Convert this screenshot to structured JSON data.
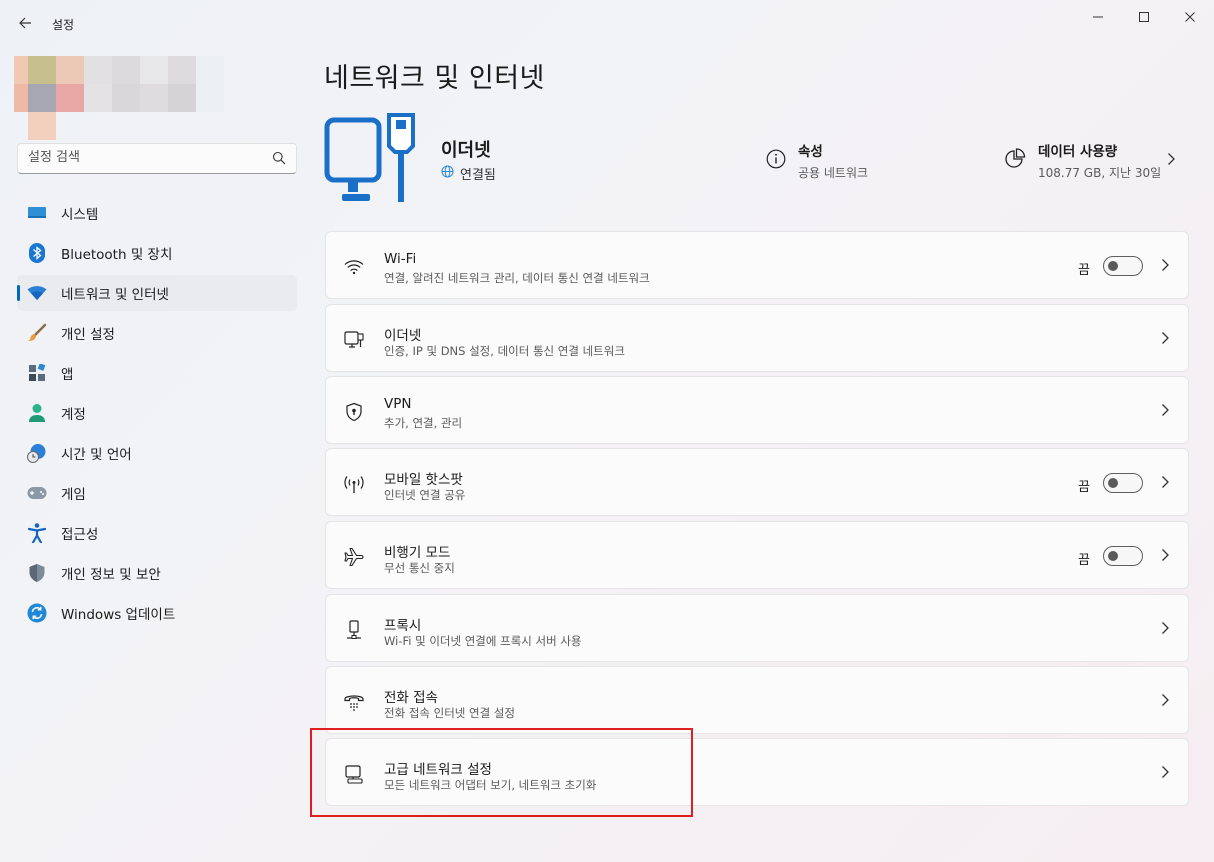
{
  "app": {
    "title": "설정"
  },
  "search": {
    "placeholder": "설정 검색"
  },
  "profile": {
    "tiles": [
      "#efc9b4",
      "#c8bf8f",
      "#ecc9b6",
      "#e2e0e2",
      "#dcdadc",
      "#e7e6e8",
      "#dddbdd",
      "#edf0f3",
      "#eeb9a6",
      "#a7a6b3",
      "#e8a7a5",
      "#e4e2e4",
      "#d9d7d9",
      "#dedcde",
      "#d5d3d5",
      "#edf0f3",
      "#f2d0bd"
    ]
  },
  "nav": {
    "items": [
      {
        "label": "시스템",
        "icon": "monitor-icon"
      },
      {
        "label": "Bluetooth 및 장치",
        "icon": "bluetooth-icon"
      },
      {
        "label": "네트워크 및 인터넷",
        "icon": "wifi-icon",
        "active": true
      },
      {
        "label": "개인 설정",
        "icon": "brush-icon"
      },
      {
        "label": "앱",
        "icon": "apps-icon"
      },
      {
        "label": "계정",
        "icon": "account-icon"
      },
      {
        "label": "시간 및 언어",
        "icon": "time-language-icon"
      },
      {
        "label": "게임",
        "icon": "gamepad-icon"
      },
      {
        "label": "접근성",
        "icon": "accessibility-icon"
      },
      {
        "label": "개인 정보 및 보안",
        "icon": "shield-icon"
      },
      {
        "label": "Windows 업데이트",
        "icon": "update-icon"
      }
    ]
  },
  "page": {
    "title": "네트워크 및 인터넷"
  },
  "header": {
    "name": "이더넷",
    "status": "연결됨",
    "properties": {
      "title": "속성",
      "sub": "공용 네트워크"
    },
    "usage": {
      "title": "데이터 사용량",
      "sub": "108.77 GB, 지난 30일"
    }
  },
  "cards": [
    {
      "title": "Wi-Fi",
      "sub": "연결, 알려진 네트워크 관리, 데이터 통신 연결 네트워크",
      "icon": "wifi-icon",
      "toggle": "끔"
    },
    {
      "title": "이더넷",
      "sub": "인증, IP 및 DNS 설정, 데이터 통신 연결 네트워크",
      "icon": "ethernet-icon"
    },
    {
      "title": "VPN",
      "sub": "추가, 연결, 관리",
      "icon": "vpn-shield-icon"
    },
    {
      "title": "모바일 핫스팟",
      "sub": "인터넷 연결 공유",
      "icon": "hotspot-icon",
      "toggle": "끔"
    },
    {
      "title": "비행기 모드",
      "sub": "무선 통신 중지",
      "icon": "airplane-icon",
      "toggle": "끔"
    },
    {
      "title": "프록시",
      "sub": "Wi-Fi 및 이더넷 연결에 프록시 서버 사용",
      "icon": "proxy-icon"
    },
    {
      "title": "전화 접속",
      "sub": "전화 접속 인터넷 연결 설정",
      "icon": "dialup-icon"
    },
    {
      "title": "고급 네트워크 설정",
      "sub": "모든 네트워크 어댑터 보기, 네트워크 초기화",
      "icon": "advanced-network-icon"
    }
  ],
  "colors": {
    "accent": "#0067c0",
    "highlight": "#e02020"
  }
}
